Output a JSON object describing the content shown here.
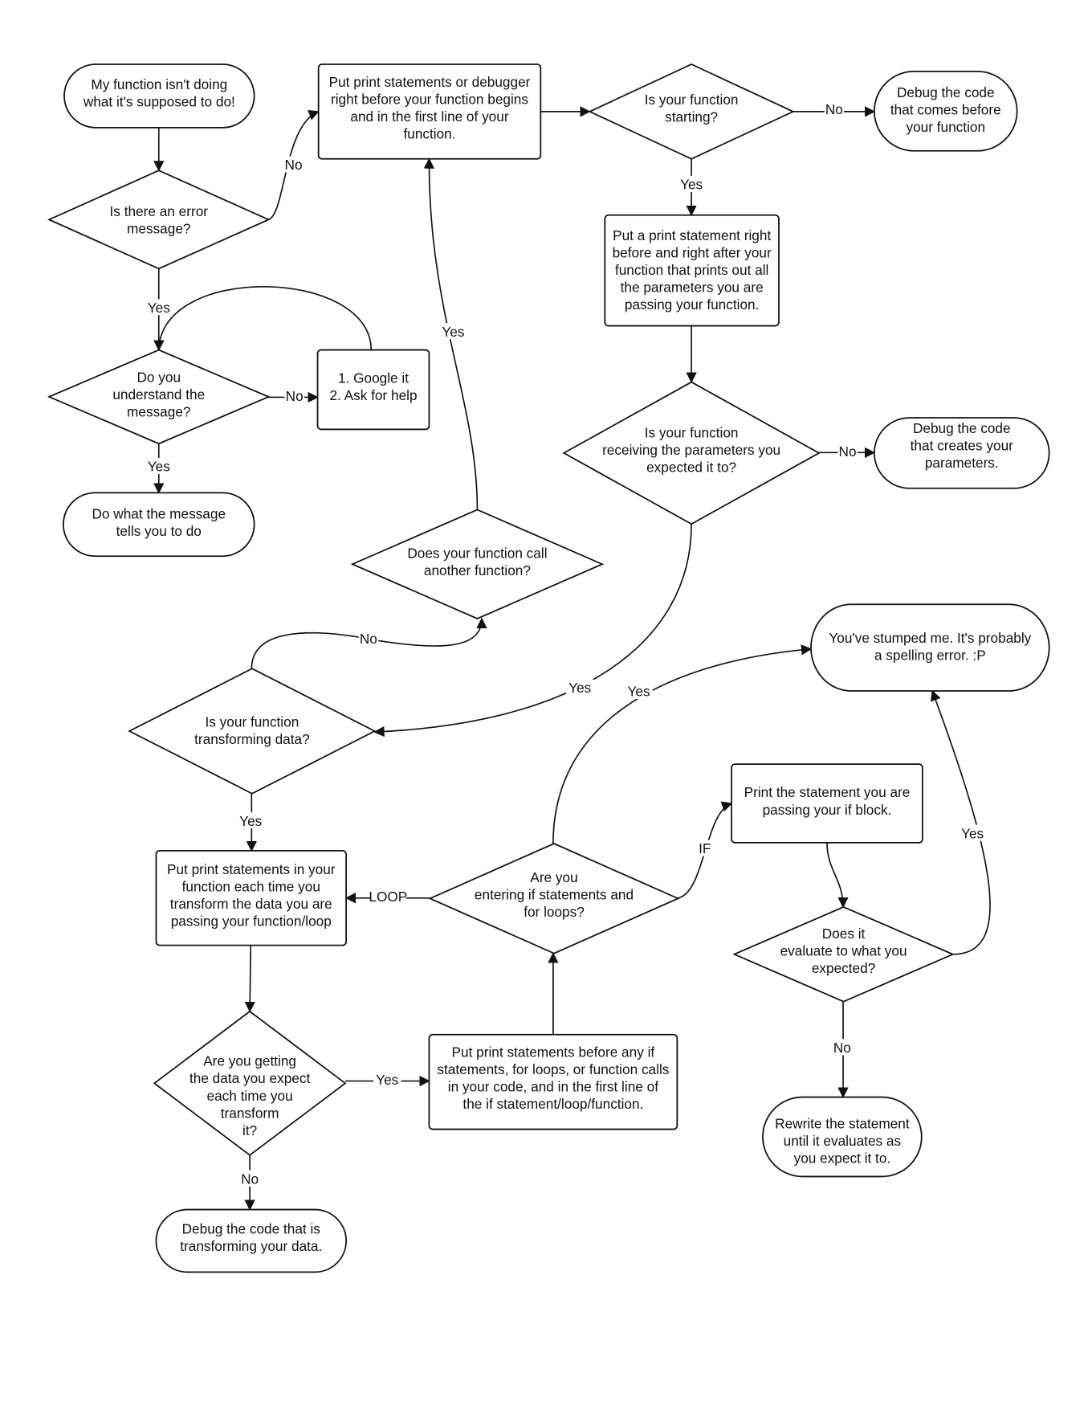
{
  "nodes": {
    "start": {
      "type": "terminal",
      "lines": [
        "My function isn't doing",
        "what it's supposed to do!"
      ]
    },
    "error": {
      "type": "decision",
      "lines": [
        "Is there an error",
        "message?"
      ]
    },
    "understand": {
      "type": "decision",
      "lines": [
        "Do you",
        "understand the",
        "message?"
      ]
    },
    "google": {
      "type": "process",
      "lines": [
        "1. Google it",
        "2. Ask for help"
      ]
    },
    "do_what": {
      "type": "terminal",
      "lines": [
        "Do what the message",
        "tells you to do"
      ]
    },
    "print_debugger": {
      "type": "process",
      "lines": [
        "Put print statements or debugger",
        "right before your function begins",
        "and in the first line of your",
        "function."
      ]
    },
    "starting": {
      "type": "decision",
      "lines": [
        "Is your function",
        "starting?"
      ]
    },
    "debug_before": {
      "type": "terminal",
      "lines": [
        "Debug the code",
        "that comes before",
        "your function"
      ]
    },
    "print_params": {
      "type": "process",
      "lines": [
        "Put a print statement right",
        "before and right after your",
        "function that prints out all",
        "the parameters you are",
        "passing your function."
      ]
    },
    "receiving": {
      "type": "decision",
      "lines": [
        "Is your function",
        "receiving the parameters you",
        "expected it to?"
      ]
    },
    "debug_params": {
      "type": "terminal",
      "lines": [
        "Debug the code",
        "that creates your",
        "parameters."
      ]
    },
    "calls": {
      "type": "decision",
      "lines": [
        "Does your function call",
        "another function?"
      ]
    },
    "stumped": {
      "type": "terminal",
      "lines": [
        "You've stumped me. It's probably",
        "a spelling error. :P"
      ]
    },
    "transforming": {
      "type": "decision",
      "lines": [
        "Is your function",
        "transforming data?"
      ]
    },
    "print_loop": {
      "type": "process",
      "lines": [
        "Put print statements in your",
        "function each time you",
        "transform the data you are",
        "passing your function/loop"
      ]
    },
    "entering": {
      "type": "decision",
      "lines": [
        "Are you",
        "entering if statements and",
        "for loops?"
      ]
    },
    "print_if": {
      "type": "process",
      "lines": [
        "Print the statement you are",
        "passing your if block."
      ]
    },
    "evaluate": {
      "type": "decision",
      "lines": [
        "Does it",
        "evaluate to what you",
        "expected?"
      ]
    },
    "getting": {
      "type": "decision",
      "lines": [
        "Are you getting",
        "the data you expect",
        "each time you",
        "transform",
        "it?"
      ]
    },
    "print_before_if": {
      "type": "process",
      "lines": [
        "Put print statements before any if",
        "statements, for loops, or function calls",
        "in your code, and in the first line of",
        "the if statement/loop/function."
      ]
    },
    "debug_transform": {
      "type": "terminal",
      "lines": [
        "Debug the code that is",
        "transforming your data."
      ]
    },
    "rewrite": {
      "type": "terminal",
      "lines": [
        "Rewrite the statement",
        "until it evaluates as",
        "you expect it to."
      ]
    }
  },
  "edges": [
    {
      "from": "start",
      "to": "error",
      "label": ""
    },
    {
      "from": "error",
      "to": "print_debugger",
      "label": "No"
    },
    {
      "from": "error",
      "to": "understand",
      "label": "Yes"
    },
    {
      "from": "google",
      "to": "understand",
      "label": ""
    },
    {
      "from": "understand",
      "to": "google",
      "label": "No"
    },
    {
      "from": "understand",
      "to": "do_what",
      "label": "Yes"
    },
    {
      "from": "print_debugger",
      "to": "starting",
      "label": ""
    },
    {
      "from": "starting",
      "to": "debug_before",
      "label": "No"
    },
    {
      "from": "starting",
      "to": "print_params",
      "label": "Yes"
    },
    {
      "from": "print_params",
      "to": "receiving",
      "label": ""
    },
    {
      "from": "receiving",
      "to": "debug_params",
      "label": "No"
    },
    {
      "from": "receiving",
      "to": "transforming",
      "label": "Yes"
    },
    {
      "from": "calls",
      "to": "print_debugger",
      "label": "Yes"
    },
    {
      "from": "transforming",
      "to": "calls",
      "label": "No"
    },
    {
      "from": "transforming",
      "to": "print_loop",
      "label": "Yes"
    },
    {
      "from": "entering",
      "to": "print_loop",
      "label": "LOOP"
    },
    {
      "from": "entering",
      "to": "print_if",
      "label": "IF"
    },
    {
      "from": "entering",
      "to": "stumped",
      "label": "Yes"
    },
    {
      "from": "print_if",
      "to": "evaluate",
      "label": ""
    },
    {
      "from": "evaluate",
      "to": "stumped",
      "label": "Yes"
    },
    {
      "from": "evaluate",
      "to": "rewrite",
      "label": "No"
    },
    {
      "from": "print_loop",
      "to": "getting",
      "label": ""
    },
    {
      "from": "getting",
      "to": "print_before_if",
      "label": "Yes"
    },
    {
      "from": "print_before_if",
      "to": "entering",
      "label": ""
    },
    {
      "from": "getting",
      "to": "debug_transform",
      "label": "No"
    }
  ]
}
